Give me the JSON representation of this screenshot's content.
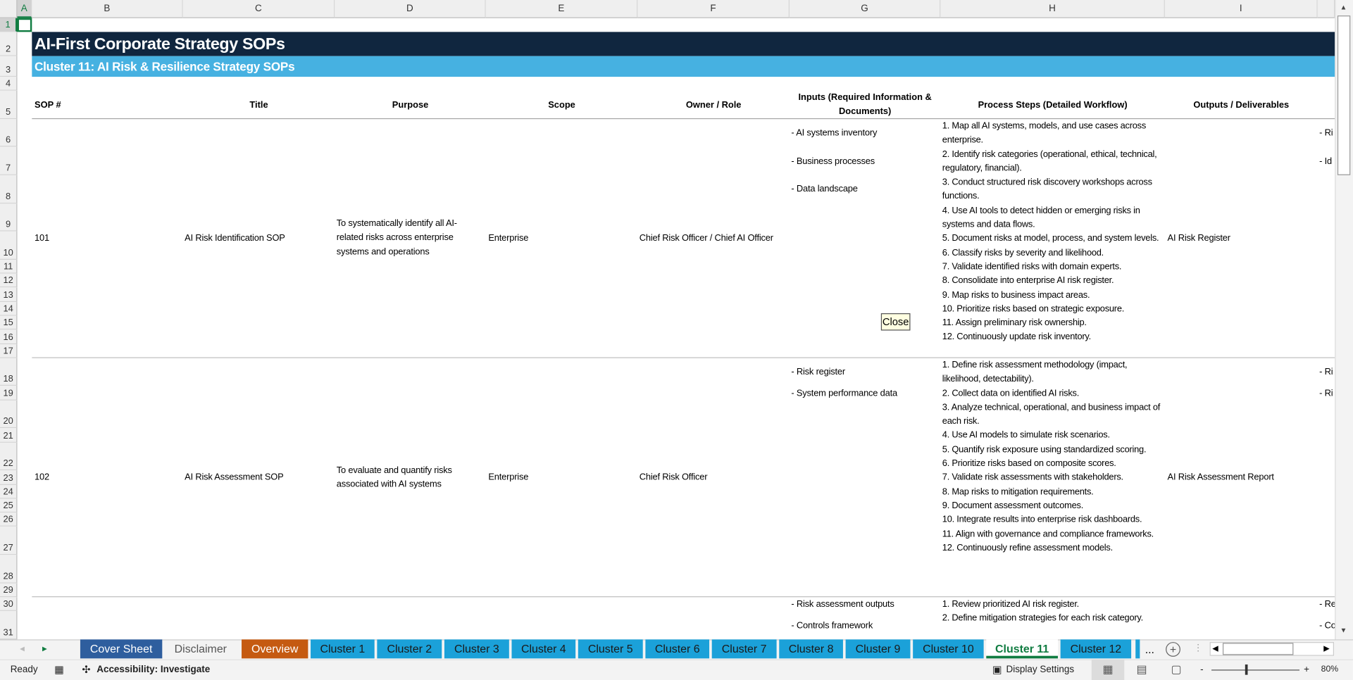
{
  "sheet": {
    "columns": [
      "A",
      "B",
      "C",
      "D",
      "E",
      "F",
      "G",
      "H",
      "I"
    ],
    "rows": [
      "1",
      "2",
      "3",
      "4",
      "5",
      "6",
      "7",
      "8",
      "9",
      "10",
      "11",
      "12",
      "13",
      "14",
      "15",
      "16",
      "17",
      "18",
      "19",
      "20",
      "21",
      "22",
      "23",
      "24",
      "25",
      "26",
      "27",
      "28",
      "29",
      "30",
      "31"
    ],
    "title": "AI-First Corporate Strategy SOPs",
    "subtitle": "Cluster 11: AI Risk & Resilience Strategy SOPs",
    "headers": {
      "sop": "SOP #",
      "title": "Title",
      "purpose": "Purpose",
      "scope": "Scope",
      "owner": "Owner / Role",
      "inputs": "Inputs (Required Information & Documents)",
      "steps": "Process Steps (Detailed Workflow)",
      "outputs": "Outputs / Deliverables"
    },
    "sops": [
      {
        "number": "101",
        "title": "AI Risk Identification SOP",
        "purpose": "To systematically identify all AI-related risks across enterprise systems and operations",
        "scope": "Enterprise",
        "owner": "Chief Risk Officer / Chief AI Officer",
        "inputs": [
          "- AI systems inventory",
          "- Business processes",
          "- Data landscape"
        ],
        "steps": [
          "1. Map all AI systems, models, and use cases across enterprise.",
          "2. Identify risk categories (operational, ethical, technical, regulatory, financial).",
          "3. Conduct structured risk discovery workshops across functions.",
          "4. Use AI tools to detect hidden or emerging risks in systems and data flows.",
          "5. Document risks at model, process, and system levels.",
          "6. Classify risks by severity and likelihood.",
          "7. Validate identified risks with domain experts.",
          "8. Consolidate into enterprise AI risk register.",
          "9. Map risks to business impact areas.",
          "10. Prioritize risks based on strategic exposure.",
          "11. Assign preliminary risk ownership.",
          "12. Continuously update risk inventory."
        ],
        "outputs": "AI Risk Register",
        "next_col": [
          "- Ri",
          "- Id"
        ]
      },
      {
        "number": "102",
        "title": "AI Risk Assessment SOP",
        "purpose": "To evaluate and quantify risks associated with AI systems",
        "scope": "Enterprise",
        "owner": "Chief Risk Officer",
        "inputs": [
          "- Risk register",
          "- System performance data"
        ],
        "steps": [
          "1. Define risk assessment methodology (impact, likelihood, detectability).",
          "2. Collect data on identified AI risks.",
          "3. Analyze technical, operational, and business impact of each risk.",
          "4. Use AI models to simulate risk scenarios.",
          "5. Quantify risk exposure using standardized scoring.",
          "6. Prioritize risks based on composite scores.",
          "7. Validate risk assessments with stakeholders.",
          "8. Map risks to mitigation requirements.",
          "9. Document assessment outcomes.",
          "10. Integrate results into enterprise risk dashboards.",
          "11. Align with governance and compliance frameworks.",
          "12. Continuously refine assessment models."
        ],
        "outputs": "AI Risk Assessment Report",
        "next_col": [
          "- Ri",
          "- Ri"
        ]
      },
      {
        "inputs": [
          "- Risk assessment outputs",
          "- Controls framework"
        ],
        "steps": [
          "1. Review prioritized AI risk register.",
          "2. Define mitigation strategies for each risk category."
        ],
        "next_col": [
          "- Re",
          "- Co"
        ]
      }
    ],
    "close_button": "Close"
  },
  "tabs": {
    "items": [
      {
        "label": "Cover Sheet",
        "color": "#2e5e9e"
      },
      {
        "label": "Disclaimer",
        "color": ""
      },
      {
        "label": "Overview",
        "color": "#c55a11"
      },
      {
        "label": "Cluster 1"
      },
      {
        "label": "Cluster 2"
      },
      {
        "label": "Cluster 3"
      },
      {
        "label": "Cluster 4"
      },
      {
        "label": "Cluster 5"
      },
      {
        "label": "Cluster 6"
      },
      {
        "label": "Cluster 7"
      },
      {
        "label": "Cluster 8"
      },
      {
        "label": "Cluster 9"
      },
      {
        "label": "Cluster 10"
      },
      {
        "label": "Cluster 11",
        "active": true
      },
      {
        "label": "Cluster 12"
      }
    ],
    "more": "...",
    "add": "+"
  },
  "status": {
    "ready": "Ready",
    "accessibility": "Accessibility: Investigate",
    "display_settings": "Display Settings",
    "zoom": "80%",
    "zoom_minus": "-",
    "zoom_plus": "+"
  },
  "colors": {
    "title_bg": "#10263f",
    "subtitle_bg": "#46b1e1",
    "tab_cluster": "#1ba1d9",
    "active_tab_text": "#107c41"
  }
}
